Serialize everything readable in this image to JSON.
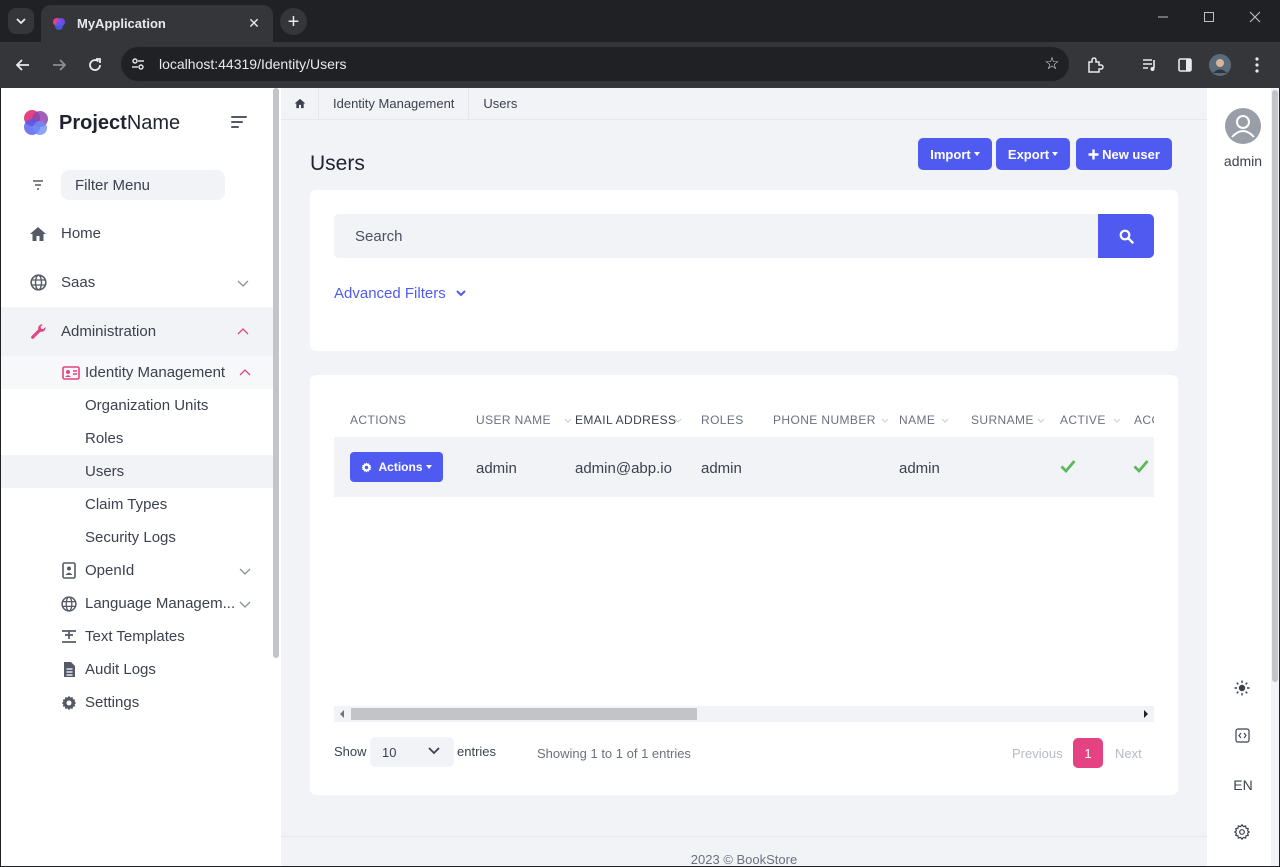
{
  "browser": {
    "tab_title": "MyApplication",
    "tab_close": "✕",
    "new_tab": "+",
    "url": "localhost:44319/Identity/Users",
    "window_controls": [
      "minimize-icon",
      "maximize-icon",
      "close-icon"
    ]
  },
  "sidebar": {
    "brand_bold": "Project",
    "brand_light": "Name",
    "filter_placeholder": "Filter Menu",
    "menu": [
      {
        "label": "Home",
        "icon": "home-icon"
      },
      {
        "label": "Saas",
        "icon": "globe-icon"
      },
      {
        "label": "Administration",
        "icon": "wrench-icon"
      }
    ],
    "identity": {
      "label": "Identity Management",
      "icon": "id-card-icon"
    },
    "identity_children": [
      "Organization Units",
      "Roles",
      "Users",
      "Claim Types",
      "Security Logs"
    ],
    "other_admin": [
      {
        "label": "OpenId",
        "icon": "openid-icon"
      },
      {
        "label": "Language Managem...",
        "icon": "globe-icon"
      },
      {
        "label": "Text Templates",
        "icon": "text-template-icon"
      },
      {
        "label": "Audit Logs",
        "icon": "file-icon"
      },
      {
        "label": "Settings",
        "icon": "gear-icon"
      }
    ],
    "accent_color": "#e44283"
  },
  "breadcrumb": {
    "items": [
      "Identity Management",
      "Users"
    ]
  },
  "page": {
    "title": "Users",
    "import_label": "Import",
    "export_label": "Export",
    "new_user_label": "New user",
    "search_placeholder": "Search",
    "advanced_filters": "Advanced Filters"
  },
  "table": {
    "columns": [
      "ACTIONS",
      "USER NAME",
      "EMAIL ADDRESS",
      "ROLES",
      "PHONE NUMBER",
      "NAME",
      "SURNAME",
      "ACTIVE",
      "ACC"
    ],
    "rows": [
      {
        "actions": "Actions",
        "user_name": "admin",
        "email": "admin@abp.io",
        "roles": "admin",
        "phone": "",
        "name": "admin",
        "surname": "",
        "active": true,
        "acc": true
      }
    ]
  },
  "pagination": {
    "show_label": "Show",
    "page_size": "10",
    "entries_label": "entries",
    "info": "Showing 1 to 1 of 1 entries",
    "previous": "Previous",
    "current_page": "1",
    "next": "Next"
  },
  "footer": "2023 © BookStore",
  "rail": {
    "user": "admin",
    "language": "EN"
  },
  "colors": {
    "primary": "#4f5bf0",
    "accent": "#e44283",
    "success": "#5cb85c"
  }
}
